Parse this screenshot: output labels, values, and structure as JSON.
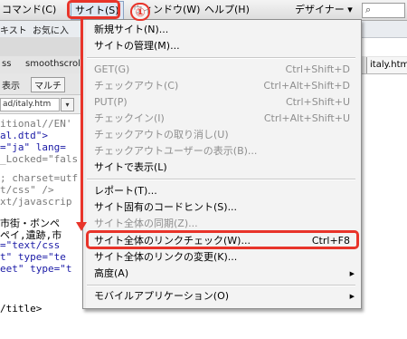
{
  "menubar": {
    "items": [
      {
        "label": "コマンド(C)"
      },
      {
        "label": "サイト(S)"
      },
      {
        "label": "ウィンドウ(W)"
      },
      {
        "label": "ヘルプ(H)"
      }
    ],
    "workspace_label": "デザイナー ▾",
    "search_icon": "⌕"
  },
  "toolbar_tabs": [
    "キスト",
    "お気に入"
  ],
  "file_tabs": [
    "ss",
    "smoothscroll.j"
  ],
  "file_tab_right": "italy.html",
  "left_panel": {
    "toolbar_label": "表示",
    "button_label": "マルチ",
    "path": "ad/italy.htm"
  },
  "code_lines": [
    "itional//EN'",
    "al.dtd\">",
    "=\"ja\" lang=",
    "_Locked=\"fals",
    "; charset=utf",
    "t/css\" />",
    "xt/javascrip",
    "市街・ボンペ",
    "ペイ,遺跡,市",
    "=\"text/css",
    "t\" type=\"te",
    "eet\" type=\"t",
    "/title>"
  ],
  "dropdown": {
    "items": [
      {
        "label": "新規サイト(N)...",
        "shortcut": "",
        "disabled": false
      },
      {
        "label": "サイトの管理(M)...",
        "shortcut": "",
        "disabled": false
      },
      {
        "label": "GET(G)",
        "shortcut": "Ctrl+Shift+D",
        "disabled": true
      },
      {
        "label": "チェックアウト(C)",
        "shortcut": "Ctrl+Alt+Shift+D",
        "disabled": true
      },
      {
        "label": "PUT(P)",
        "shortcut": "Ctrl+Shift+U",
        "disabled": true
      },
      {
        "label": "チェックイン(I)",
        "shortcut": "Ctrl+Alt+Shift+U",
        "disabled": true
      },
      {
        "label": "チェックアウトの取り消し(U)",
        "shortcut": "",
        "disabled": true
      },
      {
        "label": "チェックアウトユーザーの表示(B)...",
        "shortcut": "",
        "disabled": true
      },
      {
        "label": "サイトで表示(L)",
        "shortcut": "",
        "disabled": false
      },
      {
        "label": "レポート(T)...",
        "shortcut": "",
        "disabled": false
      },
      {
        "label": "サイト固有のコードヒント(S)...",
        "shortcut": "",
        "disabled": false
      },
      {
        "label": "サイト全体の同期(Z)...",
        "shortcut": "",
        "disabled": true
      },
      {
        "label": "サイト全体のリンクチェック(W)...",
        "shortcut": "Ctrl+F8",
        "disabled": false
      },
      {
        "label": "サイト全体のリンクの変更(K)...",
        "shortcut": "",
        "disabled": false
      },
      {
        "label": "高度(A)",
        "shortcut": "",
        "disabled": false,
        "submenu": true
      },
      {
        "label": "モバイルアプリケーション(O)",
        "shortcut": "",
        "disabled": false,
        "submenu": true
      }
    ]
  },
  "annotation": {
    "step_number": "①",
    "color": "#e8342a"
  }
}
